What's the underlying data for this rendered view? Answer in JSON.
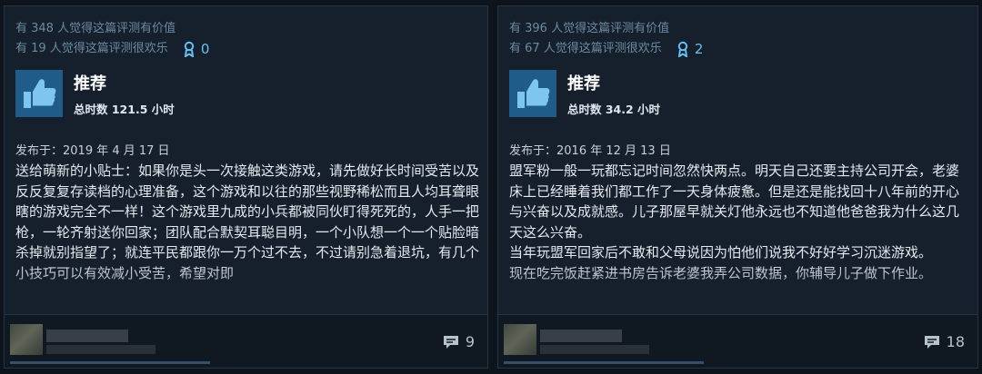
{
  "reviews": [
    {
      "helpful_text": "有 348 人觉得这篇评测有价值",
      "funny_text": "有 19 人觉得这篇评测很欢乐",
      "awards": "0",
      "recommendation": "推荐",
      "hours": "总时数 121.5 小时",
      "posted": "发布于：2019 年 4 月 17 日",
      "body": "送给萌新的小贴士：如果你是头一次接触这类游戏，请先做好长时间受苦以及反反复复存读档的心理准备，这个游戏和以往的那些视野稀松而且人均耳聋眼瞎的游戏完全不一样！这个游戏里九成的小兵都被同伙盯得死死的，人手一把枪，一轮齐射送你回家；团队配合默契耳聪目明，一个小队想一个一个贴脸暗杀掉就别指望了；就连平民都跟你一万个过不去，不过请别急着退坑，有几个小技巧可以有效减小受苦，希望对即",
      "comments": "9"
    },
    {
      "helpful_text": "有 396 人觉得这篇评测有价值",
      "funny_text": "有 67 人觉得这篇评测很欢乐",
      "awards": "2",
      "recommendation": "推荐",
      "hours": "总时数 34.2 小时",
      "posted": "发布于：2016 年 12 月 13 日",
      "body": "盟军粉一般一玩都忘记时间忽然快两点。明天自己还要主持公司开会，老婆床上已经睡着我们都工作了一天身体疲惫。但是还是能找回十八年前的开心与兴奋以及成就感。儿子那屋早就关灯他永远也不知道他爸爸我为什么这几天这么兴奋。\n当年玩盟军回家后不敢和父母说因为怕他们说我不好好学习沉迷游戏。\n现在吃完饭赶紧进书房告诉老婆我弄公司数据，你辅导儿子做下作业。",
      "comments": "18"
    }
  ],
  "colors": {
    "background": "#0e141b",
    "card": "#16202d",
    "thumb_box": "#1f5c8a",
    "accent": "#66c0f4"
  },
  "icons": {
    "award": "award-ribbon-icon",
    "thumb": "thumbs-up-icon",
    "comments": "comment-bubble-icon"
  }
}
